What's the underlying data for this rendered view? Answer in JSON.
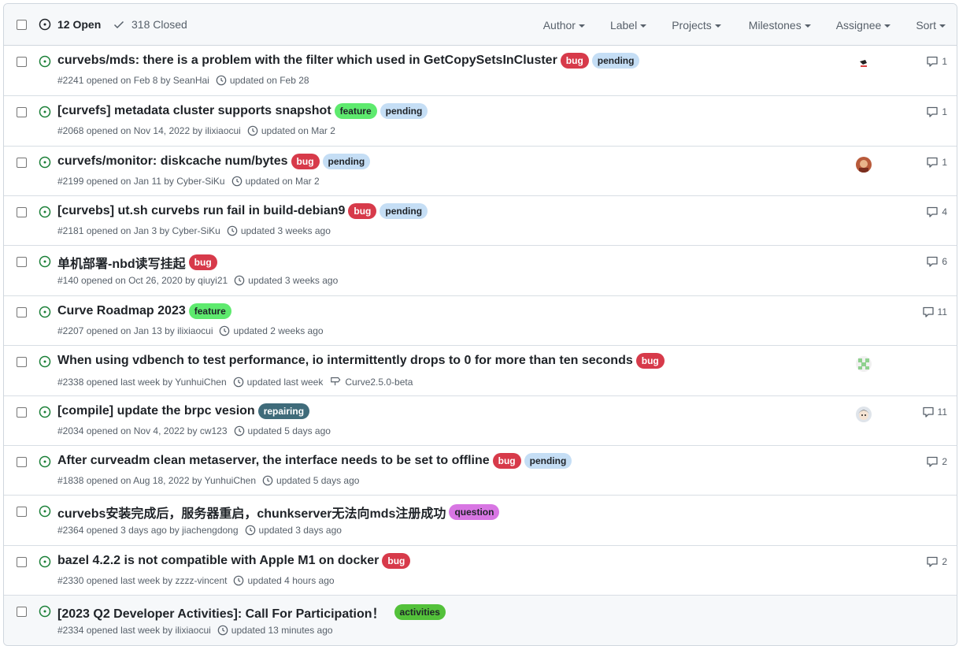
{
  "header": {
    "open_label": "12 Open",
    "closed_label": "318 Closed",
    "filters": [
      "Author",
      "Label",
      "Projects",
      "Milestones",
      "Assignee",
      "Sort"
    ]
  },
  "colors": {
    "open_green": "#1a7f37",
    "bug": "#d73a4a",
    "pending": "#c5def5",
    "feature": "#5eea6e",
    "repairing": "#3f6b7a",
    "question": "#d876e3",
    "activities": "#53c13a"
  },
  "issues": [
    {
      "title": "curvebs/mds: there is a problem with the filter which used in GetCopySetsInCluster",
      "labels": [
        {
          "name": "bug",
          "type": "bug"
        },
        {
          "name": "pending",
          "type": "pending"
        }
      ],
      "meta": "#2241 opened on Feb 8 by SeanHai",
      "updated": "updated on Feb 28",
      "milestone": "",
      "avatar": "avatar-sketch",
      "comments": "1"
    },
    {
      "title": "[curvefs] metadata cluster supports snapshot",
      "labels": [
        {
          "name": "feature",
          "type": "feature"
        },
        {
          "name": "pending",
          "type": "pending"
        }
      ],
      "meta": "#2068 opened on Nov 14, 2022 by ilixiaocui",
      "updated": "updated on Mar 2",
      "milestone": "",
      "avatar": "",
      "comments": "1"
    },
    {
      "title": "curvefs/monitor: diskcache num/bytes",
      "labels": [
        {
          "name": "bug",
          "type": "bug"
        },
        {
          "name": "pending",
          "type": "pending"
        }
      ],
      "meta": "#2199 opened on Jan 11 by Cyber-SiKu",
      "updated": "updated on Mar 2",
      "milestone": "",
      "avatar": "avatar-photo",
      "comments": "1"
    },
    {
      "title": "[curvebs] ut.sh curvebs run fail in build-debian9",
      "labels": [
        {
          "name": "bug",
          "type": "bug"
        },
        {
          "name": "pending",
          "type": "pending"
        }
      ],
      "meta": "#2181 opened on Jan 3 by Cyber-SiKu",
      "updated": "updated 3 weeks ago",
      "milestone": "",
      "avatar": "",
      "comments": "4"
    },
    {
      "title": "单机部署-nbd读写挂起",
      "labels": [
        {
          "name": "bug",
          "type": "bug"
        }
      ],
      "meta": "#140 opened on Oct 26, 2020 by qiuyi21",
      "updated": "updated 3 weeks ago",
      "milestone": "",
      "avatar": "",
      "comments": "6"
    },
    {
      "title": "Curve Roadmap 2023",
      "labels": [
        {
          "name": "feature",
          "type": "feature"
        }
      ],
      "meta": "#2207 opened on Jan 13 by ilixiaocui",
      "updated": "updated 2 weeks ago",
      "milestone": "",
      "avatar": "",
      "comments": "11"
    },
    {
      "title": "When using vdbench to test performance, io intermittently drops to 0 for more than ten seconds",
      "labels": [
        {
          "name": "bug",
          "type": "bug"
        }
      ],
      "meta": "#2338 opened last week by YunhuiChen",
      "updated": "updated last week",
      "milestone": "Curve2.5.0-beta",
      "avatar": "avatar-identicon",
      "comments": ""
    },
    {
      "title": "[compile] update the brpc vesion",
      "labels": [
        {
          "name": "repairing",
          "type": "repairing"
        }
      ],
      "meta": "#2034 opened on Nov 4, 2022 by cw123",
      "updated": "updated 5 days ago",
      "milestone": "",
      "avatar": "avatar-anime",
      "comments": "11"
    },
    {
      "title": "After curveadm clean metaserver, the interface needs to be set to offline",
      "labels": [
        {
          "name": "bug",
          "type": "bug"
        },
        {
          "name": "pending",
          "type": "pending"
        }
      ],
      "meta": "#1838 opened on Aug 18, 2022 by YunhuiChen",
      "updated": "updated 5 days ago",
      "milestone": "",
      "avatar": "",
      "comments": "2"
    },
    {
      "title": "curvebs安装完成后，服务器重启，chunkserver无法向mds注册成功",
      "labels": [
        {
          "name": "question",
          "type": "question"
        }
      ],
      "meta": "#2364 opened 3 days ago by jiachengdong",
      "updated": "updated 3 days ago",
      "milestone": "",
      "avatar": "",
      "comments": ""
    },
    {
      "title": "bazel 4.2.2 is not compatible with Apple M1 on docker",
      "labels": [
        {
          "name": "bug",
          "type": "bug"
        }
      ],
      "meta": "#2330 opened last week by zzzz-vincent",
      "updated": "updated 4 hours ago",
      "milestone": "",
      "avatar": "",
      "comments": "2"
    },
    {
      "title": "[2023 Q2 Developer Activities]: Call For Participation！",
      "labels": [
        {
          "name": "activities",
          "type": "activities"
        }
      ],
      "meta": "#2334 opened last week by ilixiaocui",
      "updated": "updated 13 minutes ago",
      "milestone": "",
      "avatar": "",
      "comments": ""
    }
  ]
}
